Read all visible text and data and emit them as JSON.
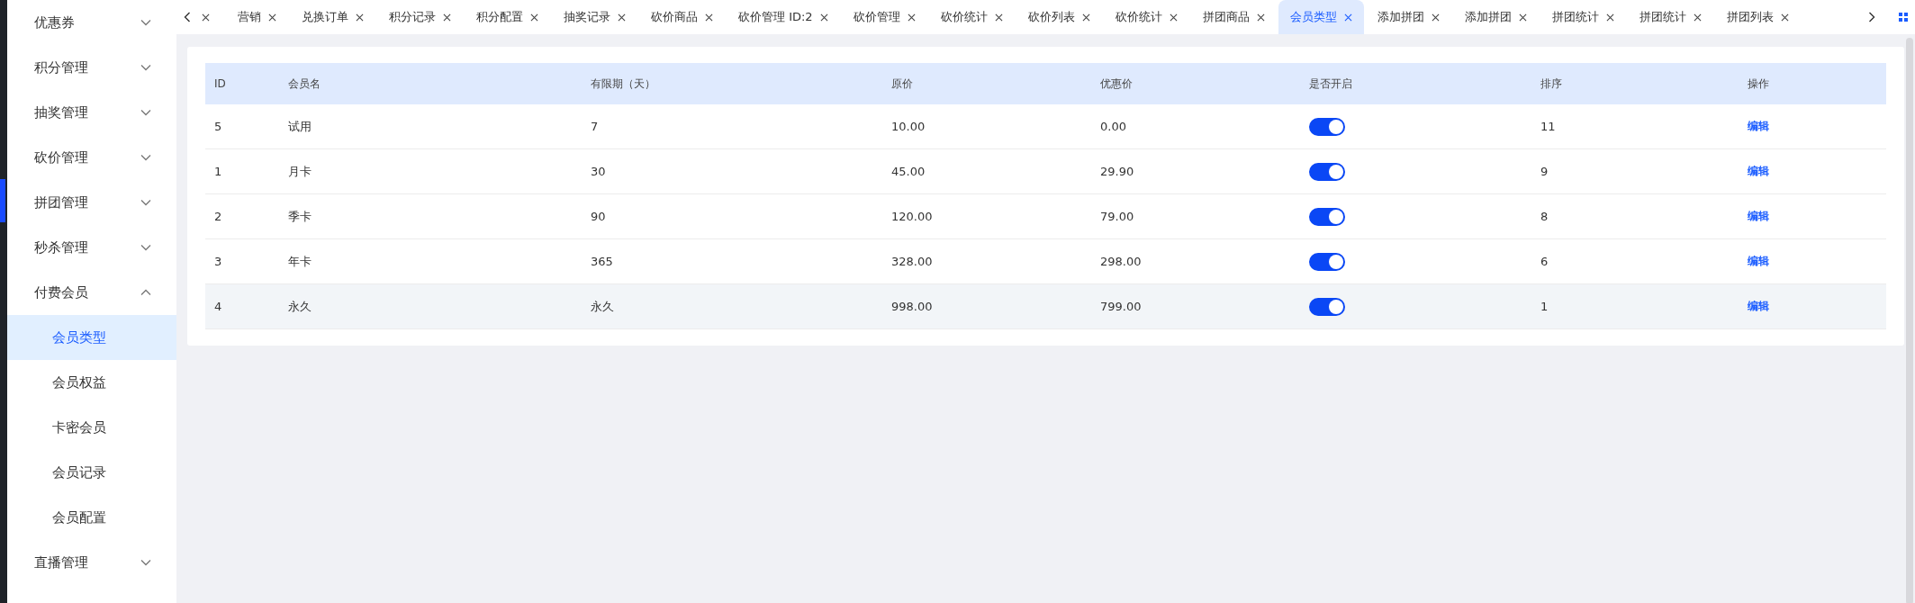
{
  "sidebar": {
    "items": [
      {
        "label": "优惠券",
        "expanded": false
      },
      {
        "label": "积分管理",
        "expanded": false
      },
      {
        "label": "抽奖管理",
        "expanded": false
      },
      {
        "label": "砍价管理",
        "expanded": false
      },
      {
        "label": "拼团管理",
        "expanded": false
      },
      {
        "label": "秒杀管理",
        "expanded": false
      },
      {
        "label": "付费会员",
        "expanded": true,
        "children": [
          {
            "label": "会员类型",
            "selected": true
          },
          {
            "label": "会员权益",
            "selected": false
          },
          {
            "label": "卡密会员",
            "selected": false
          },
          {
            "label": "会员记录",
            "selected": false
          },
          {
            "label": "会员配置",
            "selected": false
          }
        ]
      },
      {
        "label": "直播管理",
        "expanded": false
      }
    ]
  },
  "tabs": [
    {
      "label": "营销",
      "selected": false
    },
    {
      "label": "兑换订单",
      "selected": false
    },
    {
      "label": "积分记录",
      "selected": false
    },
    {
      "label": "积分配置",
      "selected": false
    },
    {
      "label": "抽奖记录",
      "selected": false
    },
    {
      "label": "砍价商品",
      "selected": false
    },
    {
      "label": "砍价管理 ID:2",
      "selected": false
    },
    {
      "label": "砍价管理",
      "selected": false
    },
    {
      "label": "砍价统计",
      "selected": false
    },
    {
      "label": "砍价列表",
      "selected": false
    },
    {
      "label": "砍价统计",
      "selected": false
    },
    {
      "label": "拼团商品",
      "selected": false
    },
    {
      "label": "会员类型",
      "selected": true
    },
    {
      "label": "添加拼团",
      "selected": false
    },
    {
      "label": "添加拼团",
      "selected": false
    },
    {
      "label": "拼团统计",
      "selected": false
    },
    {
      "label": "拼团统计",
      "selected": false
    },
    {
      "label": "拼团列表",
      "selected": false
    }
  ],
  "table": {
    "columns": [
      "ID",
      "会员名",
      "有限期（天）",
      "原价",
      "优惠价",
      "是否开启",
      "排序",
      "操作"
    ],
    "rows": [
      {
        "id": "5",
        "name": "试用",
        "period": "7",
        "price": "10.00",
        "discount": "0.00",
        "enabled": true,
        "sort": "11",
        "action": "编辑",
        "highlighted": false
      },
      {
        "id": "1",
        "name": "月卡",
        "period": "30",
        "price": "45.00",
        "discount": "29.90",
        "enabled": true,
        "sort": "9",
        "action": "编辑",
        "highlighted": false
      },
      {
        "id": "2",
        "name": "季卡",
        "period": "90",
        "price": "120.00",
        "discount": "79.00",
        "enabled": true,
        "sort": "8",
        "action": "编辑",
        "highlighted": false
      },
      {
        "id": "3",
        "name": "年卡",
        "period": "365",
        "price": "328.00",
        "discount": "298.00",
        "enabled": true,
        "sort": "6",
        "action": "编辑",
        "highlighted": false
      },
      {
        "id": "4",
        "name": "永久",
        "period": "永久",
        "price": "998.00",
        "discount": "799.00",
        "enabled": true,
        "sort": "1",
        "action": "编辑",
        "highlighted": true
      }
    ]
  }
}
